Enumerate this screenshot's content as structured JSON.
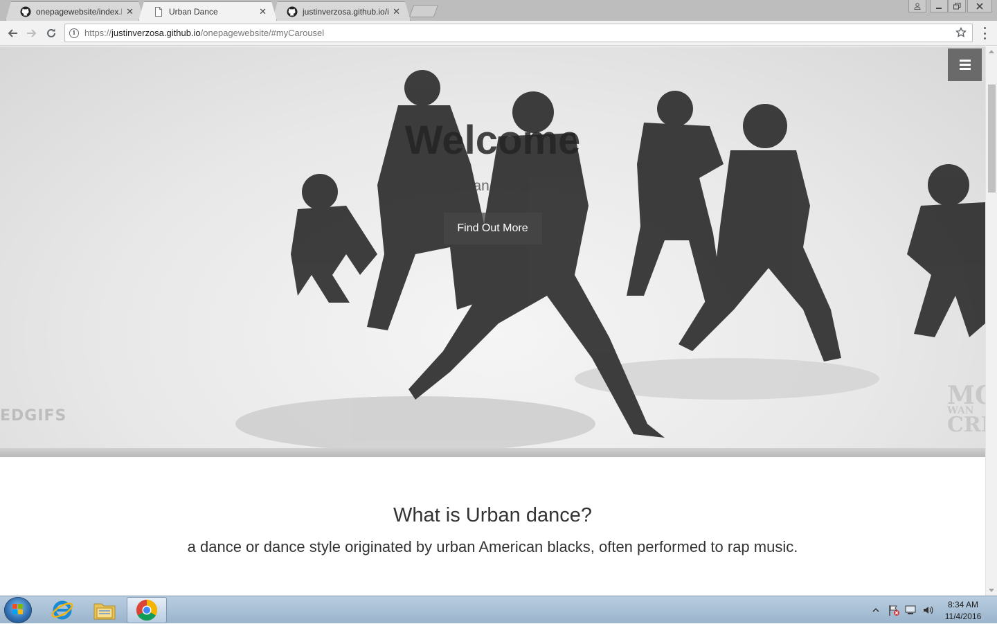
{
  "browser": {
    "tabs": [
      {
        "title": "onepagewebsite/index.h",
        "favicon": "github-icon",
        "active": false
      },
      {
        "title": "Urban Dance",
        "favicon": "page-icon",
        "active": true
      },
      {
        "title": "justinverzosa.github.io/ir",
        "favicon": "github-icon",
        "active": false
      }
    ],
    "close_glyph": "✕",
    "address": {
      "scheme": "https://",
      "host": "justinverzosa.github.io",
      "path": "/onepagewebsite/#myCarousel"
    }
  },
  "page": {
    "hero": {
      "title": "Welcome",
      "subtitle": "Urban Dance",
      "button_label": "Find Out More",
      "watermark_left": "EDGIFS",
      "watermark_right": [
        "MO",
        "WAN",
        "CRE"
      ]
    },
    "about": {
      "heading": "What is Urban dance?",
      "text": "a dance or dance style originated by urban American blacks, often performed to rap music."
    }
  },
  "taskbar": {
    "apps": [
      "start-button",
      "internet-explorer-icon",
      "file-explorer-icon",
      "chrome-icon"
    ],
    "clock": {
      "time": "8:34 AM",
      "date": "11/4/2016"
    }
  }
}
